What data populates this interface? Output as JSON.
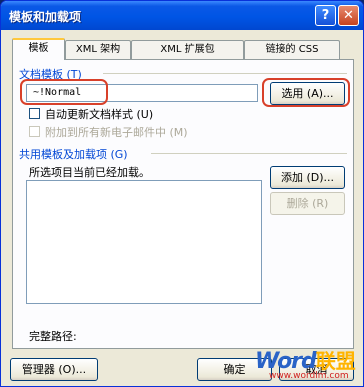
{
  "window": {
    "title": "模板和加载项",
    "help_glyph": "?",
    "close_glyph": "✕"
  },
  "tabs": [
    "模板",
    "XML 架构",
    "XML 扩展包",
    "链接的 CSS"
  ],
  "template": {
    "section_label": "文档模板 (T)",
    "value": "~!Normal",
    "choose_button": "选用 (A)...",
    "auto_update_label": "自动更新文档样式 (U)",
    "attach_all_label": "附加到所有新电子邮件中 (M)"
  },
  "global": {
    "section_label": "共用模板及加载项 (G)",
    "status_text": "所选项目当前已经加载。",
    "add_button": "添加 (D)...",
    "remove_button": "删除 (R)",
    "full_path_label": "完整路径:"
  },
  "footer": {
    "organizer_button": "管理器 (O)...",
    "ok_button": "确定",
    "cancel_button": "取消"
  },
  "watermark": {
    "brand_part1": "Word",
    "brand_part2": "联盟",
    "url": "www.wordlm.com"
  },
  "colors": {
    "titlebar": "#0055e5",
    "highlight": "#d8402a",
    "group_label": "#0046d5"
  }
}
